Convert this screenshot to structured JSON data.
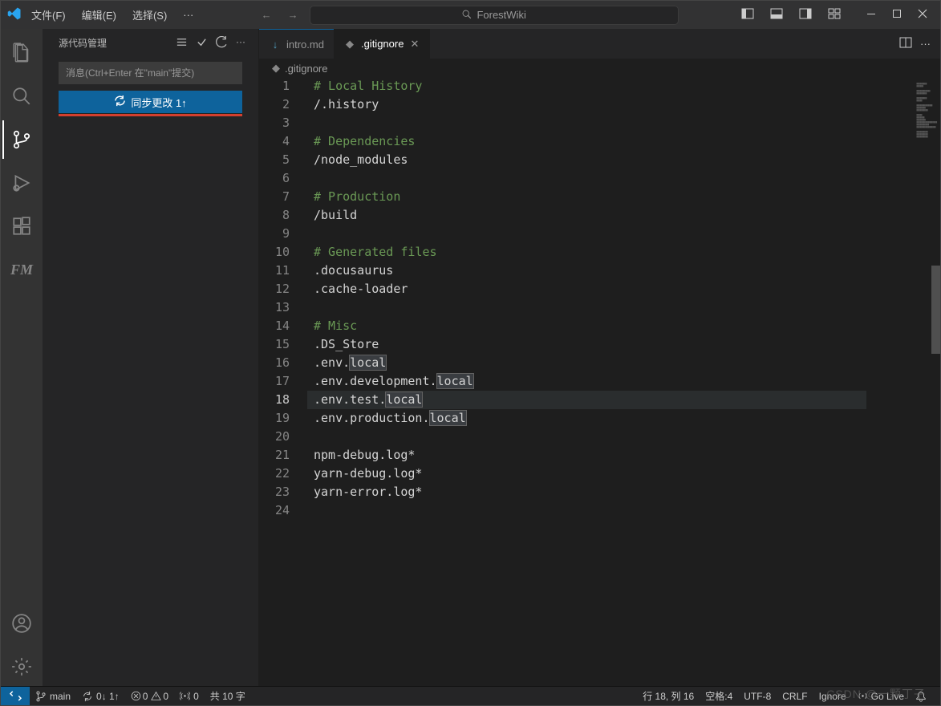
{
  "title": {
    "menu_file": "文件(F)",
    "menu_edit": "编辑(E)",
    "menu_select": "选择(S)",
    "menu_more": "···",
    "search_placeholder": "ForestWiki"
  },
  "sidebar": {
    "title": "源代码管理",
    "commit_placeholder": "消息(Ctrl+Enter 在\"main\"提交)",
    "sync_label": "同步更改 1↑"
  },
  "tabs": [
    {
      "label": "intro.md",
      "icon": "markdown",
      "accent": true
    },
    {
      "label": ".gitignore",
      "icon": "git",
      "active": true
    }
  ],
  "tab_actions": {},
  "breadcrumb": {
    "file": ".gitignore"
  },
  "code": {
    "current_line": 18,
    "lines": [
      "# Local History",
      "/.history",
      "",
      "# Dependencies",
      "/node_modules",
      "",
      "# Production",
      "/build",
      "",
      "# Generated files",
      ".docusaurus",
      ".cache-loader",
      "",
      "# Misc",
      ".DS_Store",
      ".env.local",
      ".env.development.local",
      ".env.test.local",
      ".env.production.local",
      "",
      "npm-debug.log*",
      "yarn-debug.log*",
      "yarn-error.log*",
      ""
    ],
    "highlight_word": "local"
  },
  "status": {
    "branch": "main",
    "sync": "0↓ 1↑",
    "errors": "0",
    "warnings": "0",
    "radio": "0",
    "selection": "共 10 字",
    "line_col": "行 18, 列 16",
    "spaces": "空格:4",
    "encoding": "UTF-8",
    "eol": "CRLF",
    "lang": "Ignore",
    "golive": "Go Live"
  },
  "watermark": "CSDN @一颗丁子"
}
